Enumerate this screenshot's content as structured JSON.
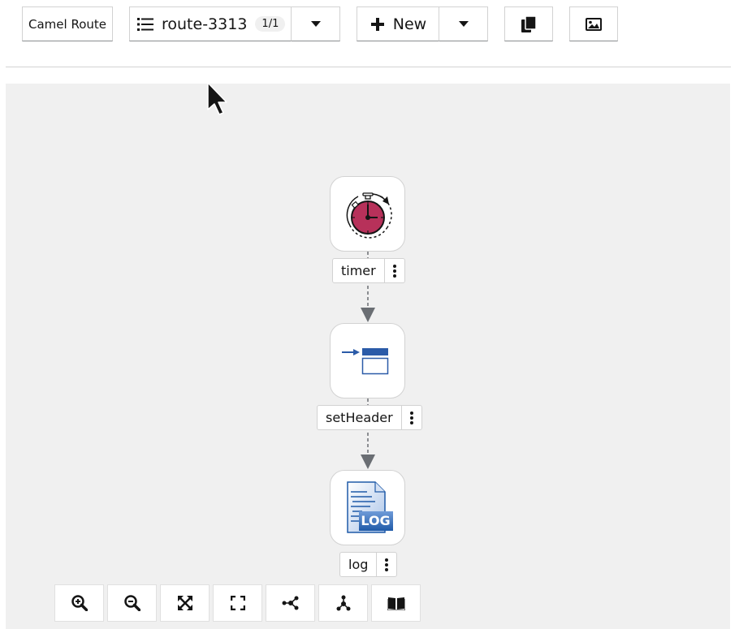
{
  "toolbar": {
    "camel_route_label": "Camel Route",
    "route_name": "route-3313",
    "route_count": "1/1",
    "new_label": "New"
  },
  "canvas": {
    "nodes": [
      {
        "label": "timer",
        "icon": "timer-icon"
      },
      {
        "label": "setHeader",
        "icon": "set-header-icon"
      },
      {
        "label": "log",
        "icon": "log-icon"
      }
    ]
  },
  "controls": [
    "zoom-in-icon",
    "zoom-out-icon",
    "fit-to-screen-icon",
    "reset-view-icon",
    "horizontal-layout-icon",
    "vertical-layout-icon",
    "legend-book-icon"
  ],
  "colors": {
    "timer_face": "#b7315a",
    "set_header_blue": "#2b5ba8",
    "log_blue": "#1f5aa8",
    "connector": "#6a6e73"
  },
  "log_icon_text": "LOG"
}
